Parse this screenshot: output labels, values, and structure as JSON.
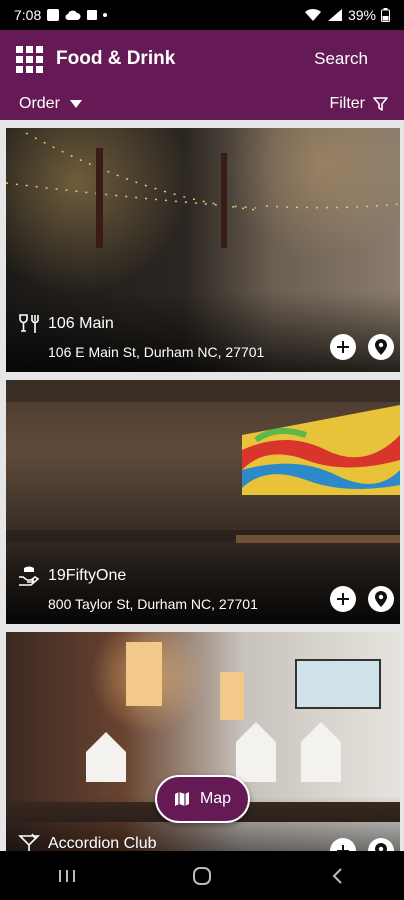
{
  "status_bar": {
    "time": "7:08",
    "battery": "39%",
    "icons": [
      "gallery-icon",
      "cloud-icon",
      "wifi-icon",
      "signal-icon",
      "battery-icon"
    ]
  },
  "app_bar": {
    "menu_icon": "grid-menu-icon",
    "title": "Food & Drink",
    "search_label": "Search",
    "order_label": "Order",
    "filter_label": "Filter"
  },
  "venues": [
    {
      "name": "106 Main",
      "address": "106 E Main St, Durham NC, 27701",
      "type_icon": "wine-fork-icon"
    },
    {
      "name": "19FiftyOne",
      "address": "800 Taylor St, Durham NC, 27701",
      "type_icon": "hand-plate-icon"
    },
    {
      "name": "Accordion Club",
      "address": "",
      "type_icon": "cocktail-icon"
    }
  ],
  "map_button": {
    "label": "Map",
    "icon": "map-icon"
  },
  "colors": {
    "brand": "#651A55",
    "status_bar": "#000000",
    "nav_bar": "#000000"
  },
  "nav_bar": {
    "buttons": [
      "recent-apps-icon",
      "home-icon",
      "back-icon"
    ]
  }
}
